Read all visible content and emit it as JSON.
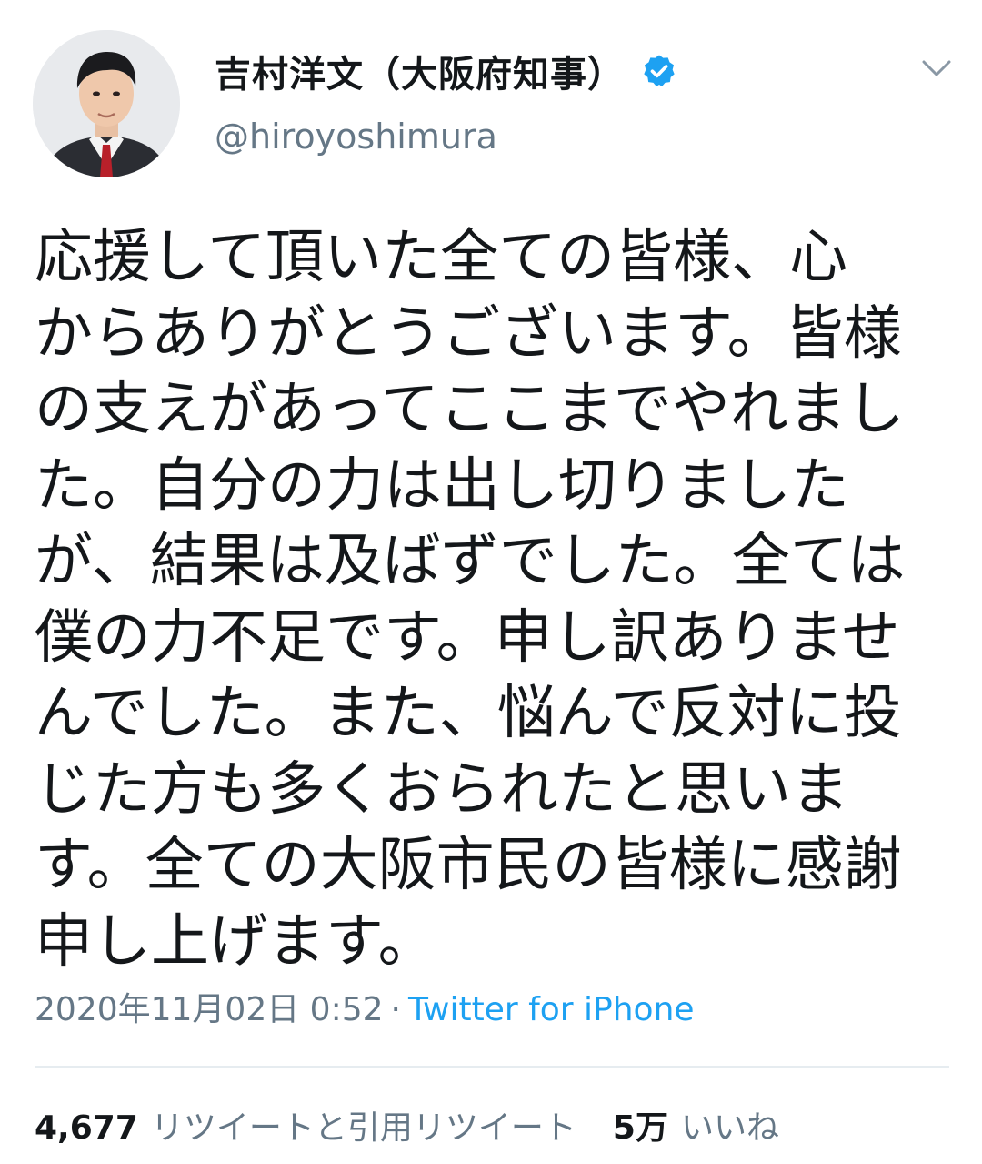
{
  "user": {
    "display_name": "吉村洋文（大阪府知事）",
    "handle": "@hiroyoshimura",
    "verified": true,
    "avatar_icon": "avatar-photo"
  },
  "menu_icon": "chevron-down-icon",
  "tweet": {
    "lines": [
      "応援して頂いた全ての皆様、心",
      "からありがとうございます。皆様",
      "の支えがあってここまでやれまし",
      "た。自分の力は出し切りました",
      "が、結果は及ばずでした。全ては",
      "僕の力不足です。申し訳ありませ",
      "んでした。また、悩んで反対に投",
      "じた方も多くおられたと思いま",
      "す。全ての大阪市民の皆様に感謝",
      "申し上げます。"
    ],
    "timestamp": "2020年11月02日 0:52",
    "separator": "·",
    "source": "Twitter for iPhone"
  },
  "stats": {
    "retweets_count": "4,677",
    "retweets_label": "リツイートと引用リツイート",
    "likes_count": "5万",
    "likes_label": "いいね"
  },
  "colors": {
    "text": "#14171a",
    "secondary": "#657786",
    "accent": "#1da1f2",
    "divider": "#e6ecf0"
  }
}
